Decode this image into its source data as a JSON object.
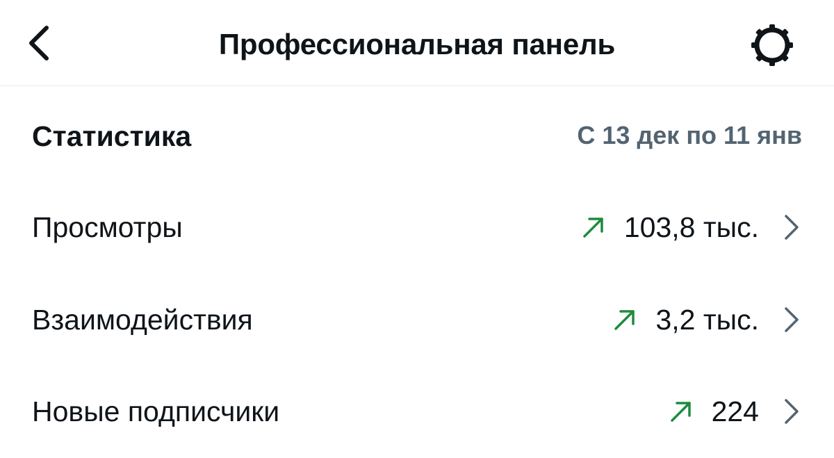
{
  "header": {
    "title": "Профессиональная панель",
    "back_icon": "chevron-left-icon",
    "settings_icon": "gear-icon"
  },
  "statistics": {
    "title": "Статистика",
    "date_range": "С 13 дек по 11 янв",
    "rows": [
      {
        "label": "Просмотры",
        "value": "103,8 тыс.",
        "trend": "up"
      },
      {
        "label": "Взаимодействия",
        "value": "3,2 тыс.",
        "trend": "up"
      },
      {
        "label": "Новые подписчики",
        "value": "224",
        "trend": "up"
      }
    ]
  },
  "colors": {
    "trend_up": "#1e8a3e",
    "secondary_text": "#536471",
    "chevron": "#536471"
  }
}
